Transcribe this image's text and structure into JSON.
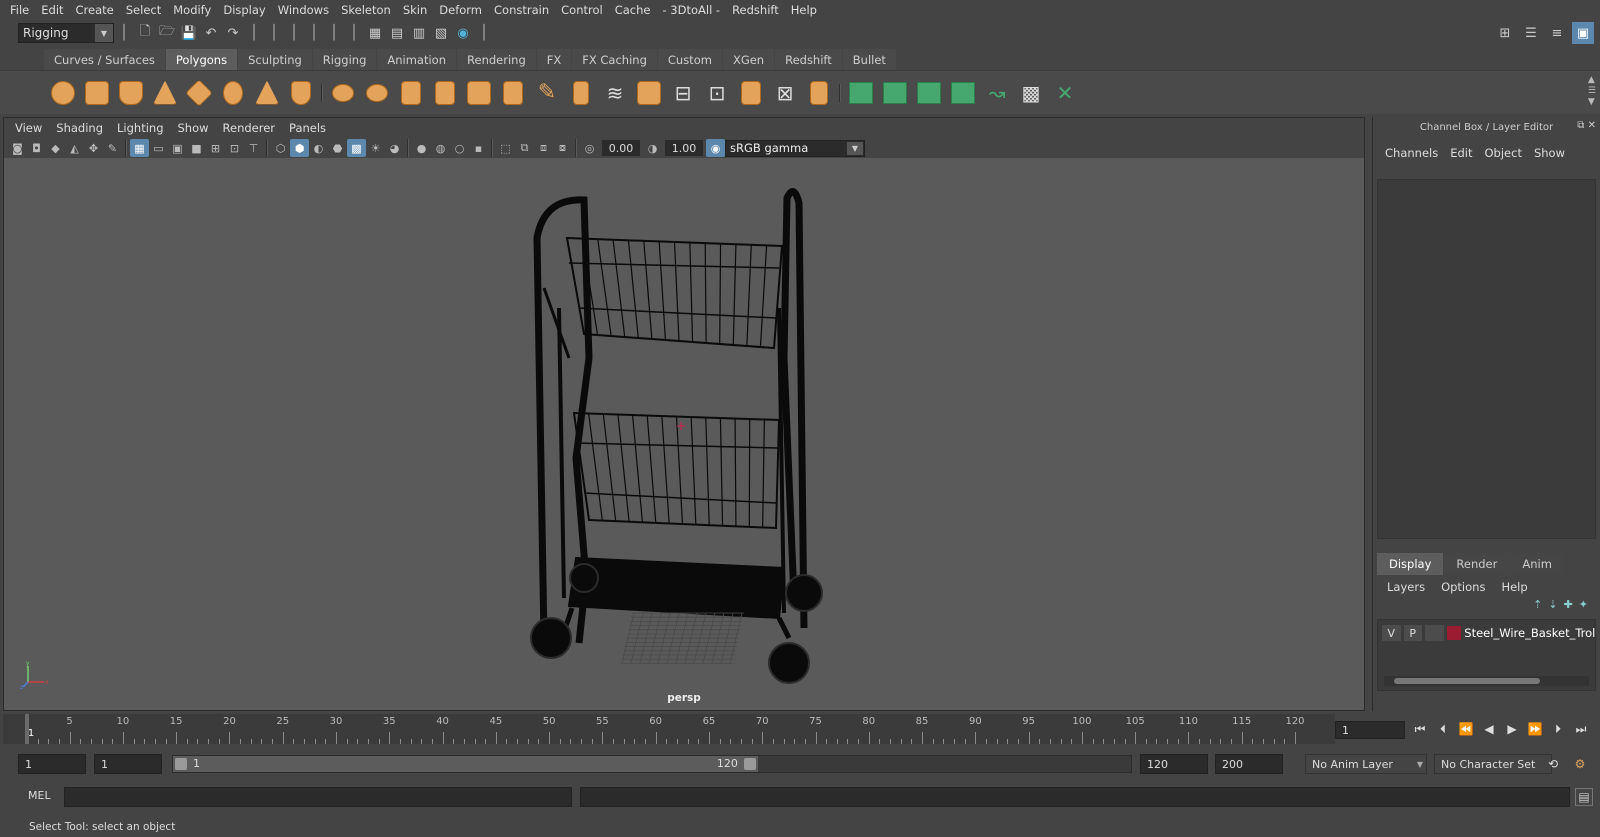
{
  "menubar": [
    "File",
    "Edit",
    "Create",
    "Select",
    "Modify",
    "Display",
    "Windows",
    "Skeleton",
    "Skin",
    "Deform",
    "Constrain",
    "Control",
    "Cache",
    "- 3DtoAll -",
    "Redshift",
    "Help"
  ],
  "statusline": {
    "mode": "Rigging"
  },
  "shelf_tabs": [
    "Curves / Surfaces",
    "Polygons",
    "Sculpting",
    "Rigging",
    "Animation",
    "Rendering",
    "FX",
    "FX Caching",
    "Custom",
    "XGen",
    "Redshift",
    "Bullet"
  ],
  "active_shelf_tab": "Polygons",
  "viewport": {
    "menu": [
      "View",
      "Shading",
      "Lighting",
      "Show",
      "Renderer",
      "Panels"
    ],
    "exposure": "0.00",
    "gamma": "1.00",
    "color_space": "sRGB gamma",
    "camera": "persp"
  },
  "channel_box": {
    "title": "Channel Box / Layer Editor",
    "menu": [
      "Channels",
      "Edit",
      "Object",
      "Show"
    ],
    "layer_tabs": [
      "Display",
      "Render",
      "Anim"
    ],
    "layer_menu": [
      "Layers",
      "Options",
      "Help"
    ],
    "layer": {
      "v": "V",
      "p": "P",
      "name": "Steel_Wire_Basket_Trolle",
      "color": "#9b1b30"
    }
  },
  "time_slider": {
    "ticks": [
      "1",
      "5",
      "10",
      "15",
      "20",
      "25",
      "30",
      "35",
      "40",
      "45",
      "50",
      "55",
      "60",
      "65",
      "70",
      "75",
      "80",
      "85",
      "90",
      "95",
      "100",
      "105",
      "110",
      "115",
      "120"
    ],
    "current_frame": "1"
  },
  "range": {
    "start": "1",
    "playback_start": "1",
    "slider_start": "1",
    "slider_end": "120",
    "playback_end": "120",
    "end": "200",
    "anim_layer": "No Anim Layer",
    "character_set": "No Character Set"
  },
  "command": {
    "language": "MEL"
  },
  "help": {
    "text": "Select Tool: select an object"
  }
}
